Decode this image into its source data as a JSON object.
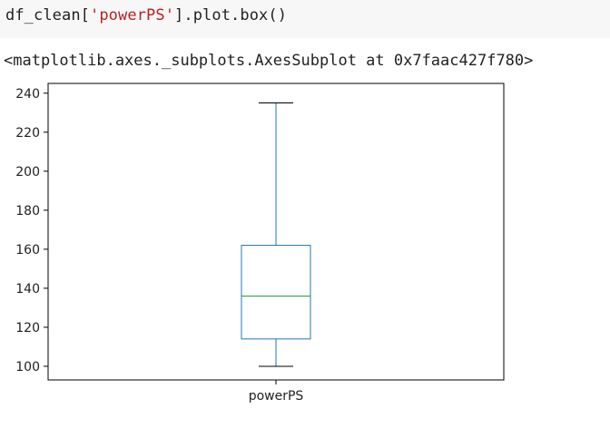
{
  "cell": {
    "code_prefix": "df_clean[",
    "code_string": "'powerPS'",
    "code_suffix": "].plot.box()",
    "output_text": "<matplotlib.axes._subplots.AxesSubplot at 0x7faac427f780>"
  },
  "colors": {
    "box": "#1f77b4",
    "median": "#2ca02c",
    "whisker_cap": "#000000",
    "string_literal": "#ba2121",
    "cell_background": "#f7f7f7"
  },
  "chart_data": {
    "type": "box",
    "categories": [
      "powerPS"
    ],
    "boxes": [
      {
        "label": "powerPS",
        "whislo": 100,
        "q1": 114,
        "median": 136,
        "q3": 162,
        "whishi": 235
      }
    ],
    "ylim": [
      93,
      245
    ],
    "yticks": [
      100,
      120,
      140,
      160,
      180,
      200,
      220,
      240
    ],
    "ytick_labels": [
      "100",
      "120",
      "140",
      "160",
      "180",
      "200",
      "220",
      "240"
    ],
    "grid": false
  }
}
